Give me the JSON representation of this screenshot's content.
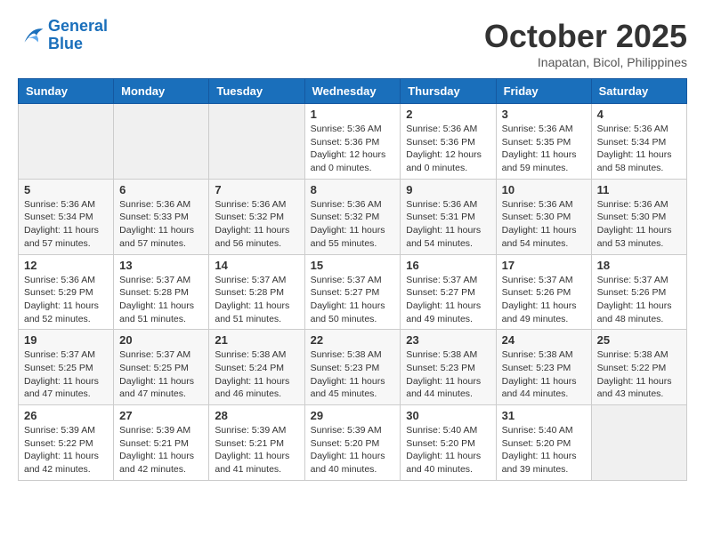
{
  "header": {
    "logo_line1": "General",
    "logo_line2": "Blue",
    "month": "October 2025",
    "location": "Inapatan, Bicol, Philippines"
  },
  "weekdays": [
    "Sunday",
    "Monday",
    "Tuesday",
    "Wednesday",
    "Thursday",
    "Friday",
    "Saturday"
  ],
  "weeks": [
    [
      {
        "day": "",
        "info": ""
      },
      {
        "day": "",
        "info": ""
      },
      {
        "day": "",
        "info": ""
      },
      {
        "day": "1",
        "info": "Sunrise: 5:36 AM\nSunset: 5:36 PM\nDaylight: 12 hours\nand 0 minutes."
      },
      {
        "day": "2",
        "info": "Sunrise: 5:36 AM\nSunset: 5:36 PM\nDaylight: 12 hours\nand 0 minutes."
      },
      {
        "day": "3",
        "info": "Sunrise: 5:36 AM\nSunset: 5:35 PM\nDaylight: 11 hours\nand 59 minutes."
      },
      {
        "day": "4",
        "info": "Sunrise: 5:36 AM\nSunset: 5:34 PM\nDaylight: 11 hours\nand 58 minutes."
      }
    ],
    [
      {
        "day": "5",
        "info": "Sunrise: 5:36 AM\nSunset: 5:34 PM\nDaylight: 11 hours\nand 57 minutes."
      },
      {
        "day": "6",
        "info": "Sunrise: 5:36 AM\nSunset: 5:33 PM\nDaylight: 11 hours\nand 57 minutes."
      },
      {
        "day": "7",
        "info": "Sunrise: 5:36 AM\nSunset: 5:32 PM\nDaylight: 11 hours\nand 56 minutes."
      },
      {
        "day": "8",
        "info": "Sunrise: 5:36 AM\nSunset: 5:32 PM\nDaylight: 11 hours\nand 55 minutes."
      },
      {
        "day": "9",
        "info": "Sunrise: 5:36 AM\nSunset: 5:31 PM\nDaylight: 11 hours\nand 54 minutes."
      },
      {
        "day": "10",
        "info": "Sunrise: 5:36 AM\nSunset: 5:30 PM\nDaylight: 11 hours\nand 54 minutes."
      },
      {
        "day": "11",
        "info": "Sunrise: 5:36 AM\nSunset: 5:30 PM\nDaylight: 11 hours\nand 53 minutes."
      }
    ],
    [
      {
        "day": "12",
        "info": "Sunrise: 5:36 AM\nSunset: 5:29 PM\nDaylight: 11 hours\nand 52 minutes."
      },
      {
        "day": "13",
        "info": "Sunrise: 5:37 AM\nSunset: 5:28 PM\nDaylight: 11 hours\nand 51 minutes."
      },
      {
        "day": "14",
        "info": "Sunrise: 5:37 AM\nSunset: 5:28 PM\nDaylight: 11 hours\nand 51 minutes."
      },
      {
        "day": "15",
        "info": "Sunrise: 5:37 AM\nSunset: 5:27 PM\nDaylight: 11 hours\nand 50 minutes."
      },
      {
        "day": "16",
        "info": "Sunrise: 5:37 AM\nSunset: 5:27 PM\nDaylight: 11 hours\nand 49 minutes."
      },
      {
        "day": "17",
        "info": "Sunrise: 5:37 AM\nSunset: 5:26 PM\nDaylight: 11 hours\nand 49 minutes."
      },
      {
        "day": "18",
        "info": "Sunrise: 5:37 AM\nSunset: 5:26 PM\nDaylight: 11 hours\nand 48 minutes."
      }
    ],
    [
      {
        "day": "19",
        "info": "Sunrise: 5:37 AM\nSunset: 5:25 PM\nDaylight: 11 hours\nand 47 minutes."
      },
      {
        "day": "20",
        "info": "Sunrise: 5:37 AM\nSunset: 5:25 PM\nDaylight: 11 hours\nand 47 minutes."
      },
      {
        "day": "21",
        "info": "Sunrise: 5:38 AM\nSunset: 5:24 PM\nDaylight: 11 hours\nand 46 minutes."
      },
      {
        "day": "22",
        "info": "Sunrise: 5:38 AM\nSunset: 5:23 PM\nDaylight: 11 hours\nand 45 minutes."
      },
      {
        "day": "23",
        "info": "Sunrise: 5:38 AM\nSunset: 5:23 PM\nDaylight: 11 hours\nand 44 minutes."
      },
      {
        "day": "24",
        "info": "Sunrise: 5:38 AM\nSunset: 5:23 PM\nDaylight: 11 hours\nand 44 minutes."
      },
      {
        "day": "25",
        "info": "Sunrise: 5:38 AM\nSunset: 5:22 PM\nDaylight: 11 hours\nand 43 minutes."
      }
    ],
    [
      {
        "day": "26",
        "info": "Sunrise: 5:39 AM\nSunset: 5:22 PM\nDaylight: 11 hours\nand 42 minutes."
      },
      {
        "day": "27",
        "info": "Sunrise: 5:39 AM\nSunset: 5:21 PM\nDaylight: 11 hours\nand 42 minutes."
      },
      {
        "day": "28",
        "info": "Sunrise: 5:39 AM\nSunset: 5:21 PM\nDaylight: 11 hours\nand 41 minutes."
      },
      {
        "day": "29",
        "info": "Sunrise: 5:39 AM\nSunset: 5:20 PM\nDaylight: 11 hours\nand 40 minutes."
      },
      {
        "day": "30",
        "info": "Sunrise: 5:40 AM\nSunset: 5:20 PM\nDaylight: 11 hours\nand 40 minutes."
      },
      {
        "day": "31",
        "info": "Sunrise: 5:40 AM\nSunset: 5:20 PM\nDaylight: 11 hours\nand 39 minutes."
      },
      {
        "day": "",
        "info": ""
      }
    ]
  ]
}
